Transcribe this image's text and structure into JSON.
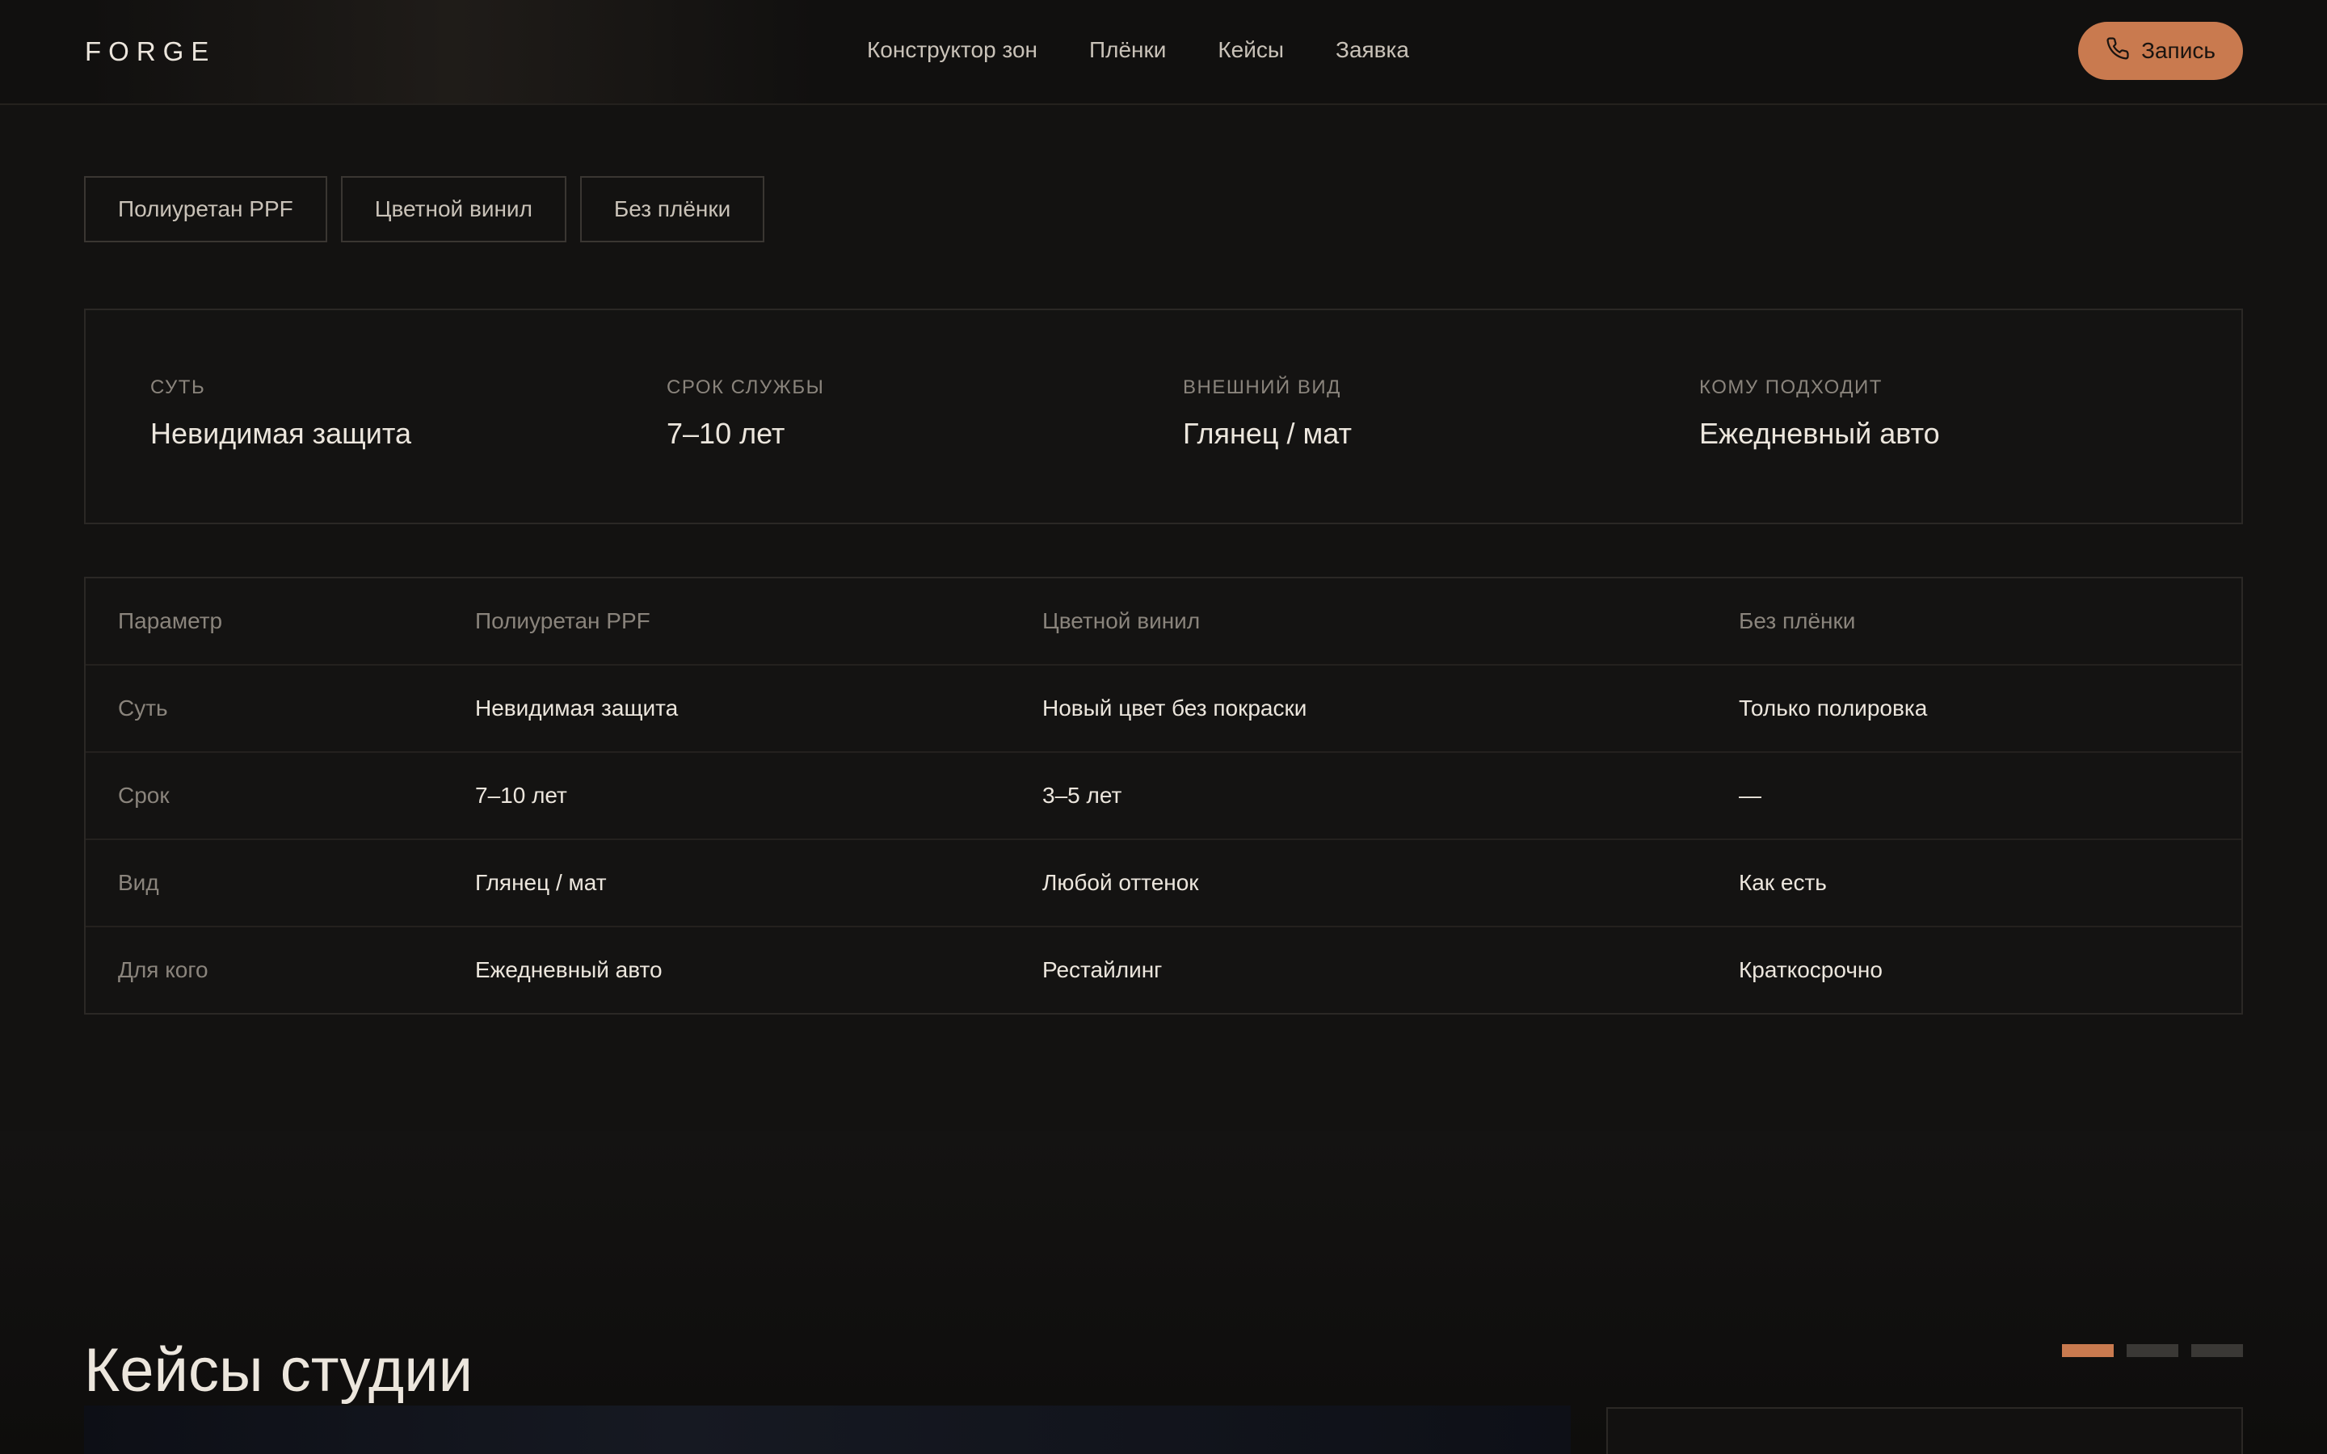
{
  "header": {
    "logo": "FORGE",
    "nav": [
      "Конструктор зон",
      "Плёнки",
      "Кейсы",
      "Заявка"
    ],
    "cta_label": "Запись",
    "cta_icon": "phone-icon"
  },
  "film_tabs": {
    "items": [
      "Полиуретан PPF",
      "Цветной винил",
      "Без плёнки"
    ],
    "active_index": 0
  },
  "summary": [
    {
      "label": "Суть",
      "value": "Невидимая защита"
    },
    {
      "label": "Срок службы",
      "value": "7–10 лет"
    },
    {
      "label": "Внешний вид",
      "value": "Глянец / мат"
    },
    {
      "label": "Кому подходит",
      "value": "Ежедневный авто"
    }
  ],
  "comparison": {
    "columns": [
      "Параметр",
      "Полиуретан PPF",
      "Цветной винил",
      "Без плёнки"
    ],
    "rows": [
      [
        "Суть",
        "Невидимая защита",
        "Новый цвет без покраски",
        "Только полировка"
      ],
      [
        "Срок",
        "7–10 лет",
        "3–5 лет",
        "—"
      ],
      [
        "Вид",
        "Глянец / мат",
        "Любой оттенок",
        "Как есть"
      ],
      [
        "Для кого",
        "Ежедневный авто",
        "Рестайлинг",
        "Краткосрочно"
      ]
    ]
  },
  "cases": {
    "title": "Кейсы студии",
    "slides_total": 3,
    "active_slide": 0
  },
  "colors": {
    "accent": "#c97a4f",
    "background": "#131211",
    "text": "#ece6dd",
    "muted": "#8a847c"
  }
}
